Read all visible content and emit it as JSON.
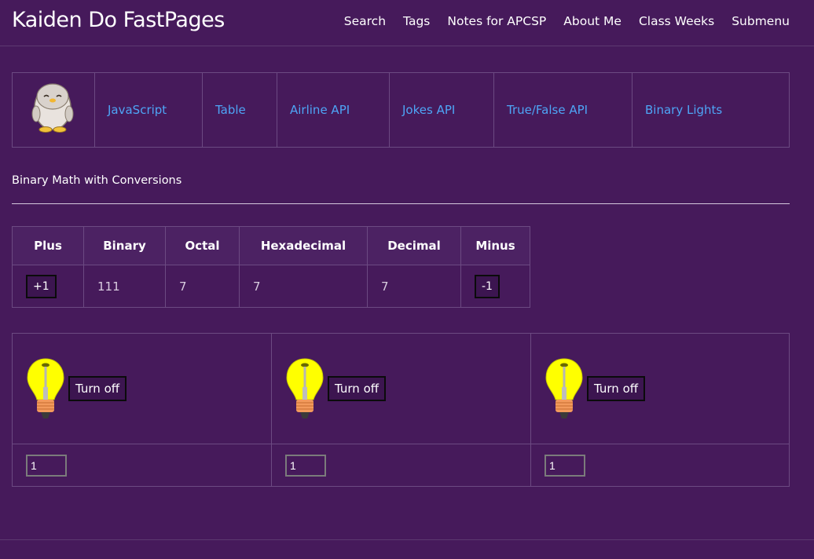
{
  "site": {
    "title": "Kaiden Do FastPages"
  },
  "nav": [
    "Search",
    "Tags",
    "Notes for APCSP",
    "About Me",
    "Class Weeks",
    "Submenu"
  ],
  "links": [
    "JavaScript",
    "Table",
    "Airline API",
    "Jokes API",
    "True/False API",
    "Binary Lights"
  ],
  "page": {
    "subtitle": "Binary Math with Conversions"
  },
  "converter": {
    "headers": [
      "Plus",
      "Binary",
      "Octal",
      "Hexadecimal",
      "Decimal",
      "Minus"
    ],
    "plus_label": "+1",
    "binary": "111",
    "octal": "7",
    "hexadecimal": "7",
    "decimal": "7",
    "minus_label": "-1"
  },
  "bits": [
    {
      "button": "Turn off",
      "value": "1"
    },
    {
      "button": "Turn off",
      "value": "1"
    },
    {
      "button": "Turn off",
      "value": "1"
    }
  ],
  "colors": {
    "background": "#461a5b",
    "link": "#4ea5f6",
    "bulb": "#ffff00"
  }
}
